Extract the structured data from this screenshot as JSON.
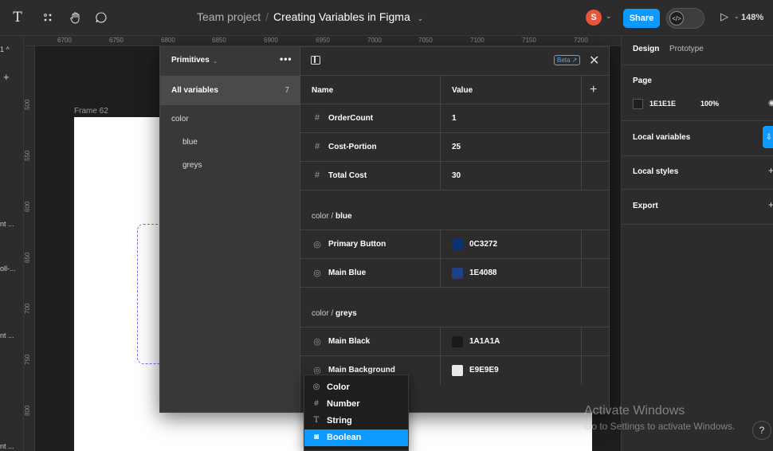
{
  "toolbar": {
    "breadcrumb_project": "Team project",
    "breadcrumb_separator": "/",
    "file_name": "Creating Variables in Figma",
    "avatar_initial": "S",
    "share_label": "Share",
    "dev_mode_icon": "</>",
    "zoom": "148%",
    "tools": [
      "text-tool-icon",
      "component-icon",
      "hand-tool-icon",
      "comment-icon"
    ]
  },
  "ruler": {
    "top": [
      "6700",
      "6750",
      "6800",
      "6850",
      "6900",
      "6950",
      "7000",
      "7050",
      "7100",
      "7150",
      "7200"
    ],
    "left": [
      "500",
      "550",
      "600",
      "650",
      "700",
      "750",
      "800"
    ]
  },
  "left_sidebar": {
    "top_label": "1 ^",
    "plus": "+",
    "items": [
      "nt ...",
      "oll-...",
      "nt ...",
      "nt ..."
    ]
  },
  "canvas": {
    "frame_label": "Frame 62"
  },
  "variables_modal": {
    "collection_name": "Primitives",
    "more": "•••",
    "all_variables_label": "All variables",
    "all_variables_count": "7",
    "groups": [
      {
        "label": "color",
        "indent": 0
      },
      {
        "label": "blue",
        "indent": 1
      },
      {
        "label": "greys",
        "indent": 1
      }
    ],
    "beta_label": "Beta ↗",
    "close": "✕",
    "column_name": "Name",
    "column_value": "Value",
    "add": "+",
    "number_rows": [
      {
        "icon": "#",
        "name": "OrderCount",
        "value": "1"
      },
      {
        "icon": "#",
        "name": "Cost-Portion",
        "value": "25"
      },
      {
        "icon": "#",
        "name": "Total Cost",
        "value": "30"
      }
    ],
    "group_blue": {
      "prefix": "color / ",
      "name": "blue"
    },
    "blue_rows": [
      {
        "name": "Primary Button",
        "value": "0C3272",
        "swatch": "#0c3272"
      },
      {
        "name": "Main Blue",
        "value": "1E4088",
        "swatch": "#1e4088"
      }
    ],
    "group_greys": {
      "prefix": "color / ",
      "name": "greys"
    },
    "grey_rows": [
      {
        "name": "Main Black",
        "value": "1A1A1A",
        "swatch": "#1a1a1a"
      },
      {
        "name": "Main Background",
        "value": "E9E9E9",
        "swatch": "#e9e9e9"
      }
    ]
  },
  "type_dropdown": {
    "items": [
      {
        "icon": "◎",
        "label": "Color",
        "selected": false
      },
      {
        "icon": "#",
        "label": "Number",
        "selected": false
      },
      {
        "icon": "T",
        "label": "String",
        "selected": false
      },
      {
        "icon": "◙",
        "label": "Boolean",
        "selected": true
      }
    ]
  },
  "right_panel": {
    "tab_design": "Design",
    "tab_prototype": "Prototype",
    "page_heading": "Page",
    "page_bg_hex": "1E1E1E",
    "page_bg_opacity": "100%",
    "local_variables": "Local variables",
    "local_styles": "Local styles",
    "export": "Export",
    "plus": "+"
  },
  "watermark": {
    "title": "Activate Windows",
    "subtitle": "Go to Settings to activate Windows."
  },
  "colors": {
    "accent": "#0d99ff",
    "panel": "#2c2c2c",
    "canvas": "#1e1e1e",
    "avatar": "#e8553a"
  }
}
